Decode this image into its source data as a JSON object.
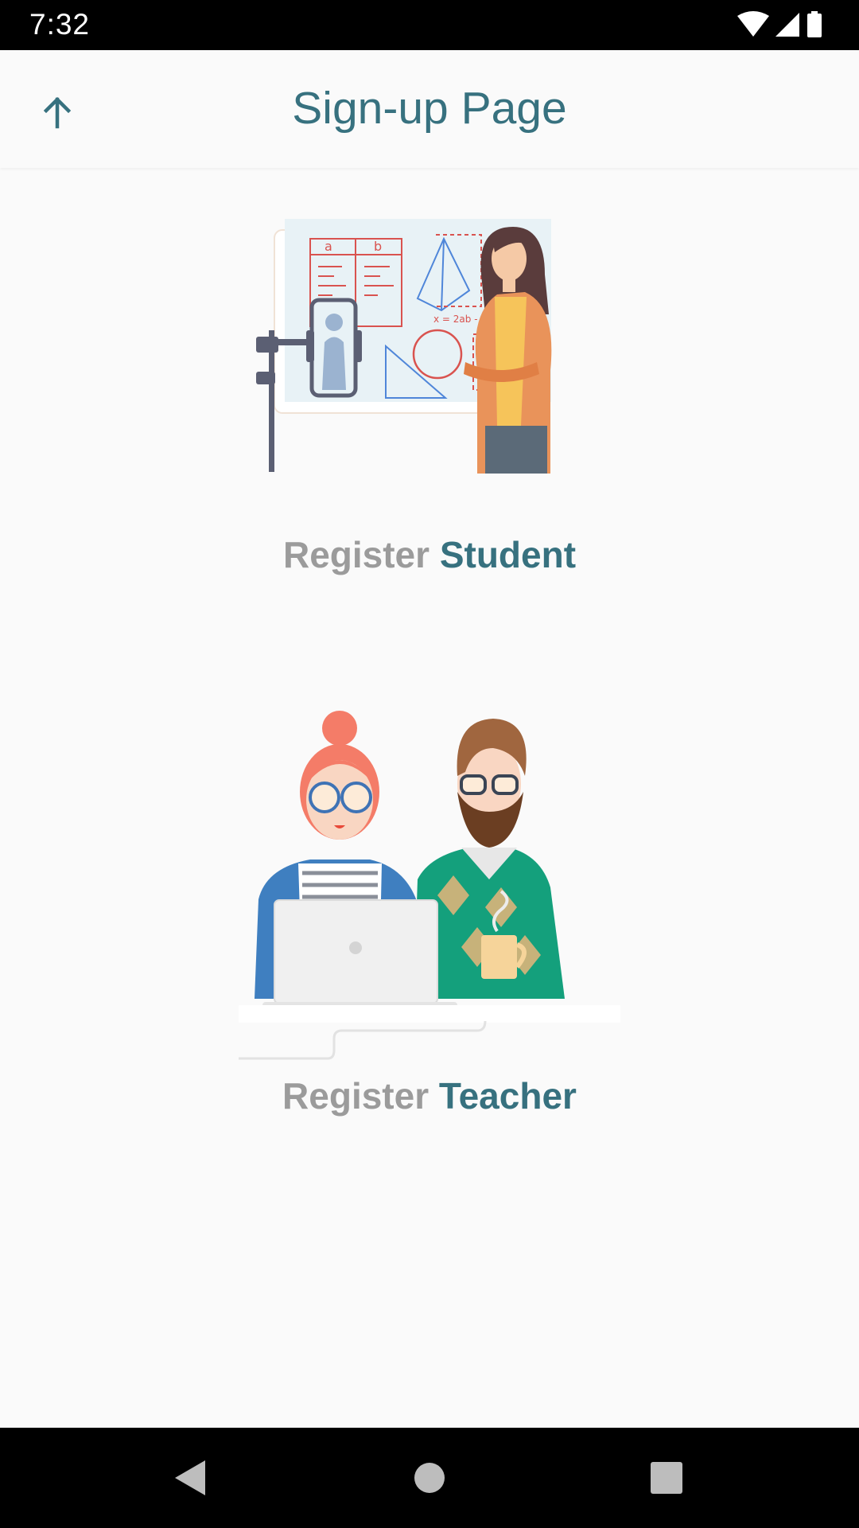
{
  "status_bar": {
    "time": "7:32",
    "icons": [
      "wifi-icon",
      "cell-signal-icon",
      "battery-icon"
    ]
  },
  "app_bar": {
    "title": "Sign-up Page",
    "back_icon": "arrow-up-icon"
  },
  "options": [
    {
      "label_prefix": "Register",
      "label_role": "Student",
      "illustration": "teacher-at-whiteboard-illustration"
    },
    {
      "label_prefix": "Register",
      "label_role": "Teacher",
      "illustration": "two-people-laptop-illustration"
    }
  ],
  "nav_bar": {
    "icons": [
      "back-triangle-icon",
      "home-circle-icon",
      "recents-square-icon"
    ]
  },
  "colors": {
    "accent": "#37717f",
    "label_gray": "#9b9b9b",
    "background": "#fafafa"
  }
}
